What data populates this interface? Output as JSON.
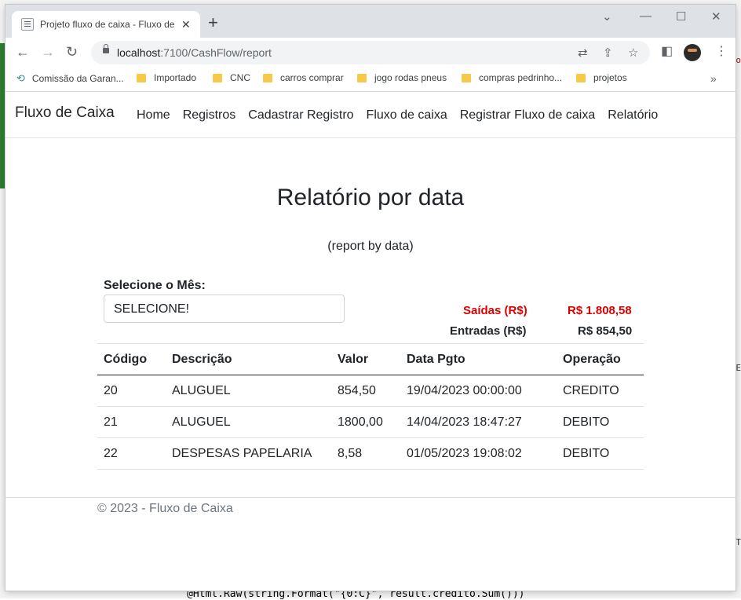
{
  "browser": {
    "tab_title": "Projeto fluxo de caixa - Fluxo de",
    "url_host": "localhost",
    "url_path": ":7100/CashFlow/report",
    "bookmarks": [
      {
        "label": "Comissão da Garan..."
      },
      {
        "label": "Importado"
      },
      {
        "label": "CNC"
      },
      {
        "label": "carros comprar"
      },
      {
        "label": "jogo rodas pneus"
      },
      {
        "label": "compras pedrinho..."
      },
      {
        "label": "projetos"
      }
    ]
  },
  "navbar": {
    "brand": "Fluxo de Caixa",
    "links": [
      "Home",
      "Registros",
      "Cadastrar Registro",
      "Fluxo de caixa",
      "Registrar Fluxo de caixa",
      "Relatório"
    ]
  },
  "main": {
    "title": "Relatório por data",
    "subtitle": "(report by data)",
    "filter_label": "Selecione o Mês:",
    "filter_value": "SELECIONE!",
    "summary": {
      "saidas_label": "Saídas (R$)",
      "saidas_value": "R$ 1.808,58",
      "entradas_label": "Entradas (R$)",
      "entradas_value": "R$ 854,50",
      "saidas_color": "#dc0000"
    },
    "table": {
      "headers": [
        "Código",
        "Descrição",
        "Valor",
        "Data Pgto",
        "Operação"
      ],
      "rows": [
        [
          "20",
          "ALUGUEL",
          "854,50",
          "19/04/2023 00:00:00",
          "CREDITO"
        ],
        [
          "21",
          "ALUGUEL",
          "1800,00",
          "14/04/2023 18:47:27",
          "DEBITO"
        ],
        [
          "22",
          "DESPESAS PAPELARIA",
          "8,58",
          "01/05/2023 19:08:02",
          "DEBITO"
        ]
      ]
    }
  },
  "footer": {
    "text": "© 2023 - Fluxo de Caixa"
  },
  "background": {
    "code_text": "@Html.Raw(string.Format(\"{0:C}\", result.credito.Sum()))"
  }
}
